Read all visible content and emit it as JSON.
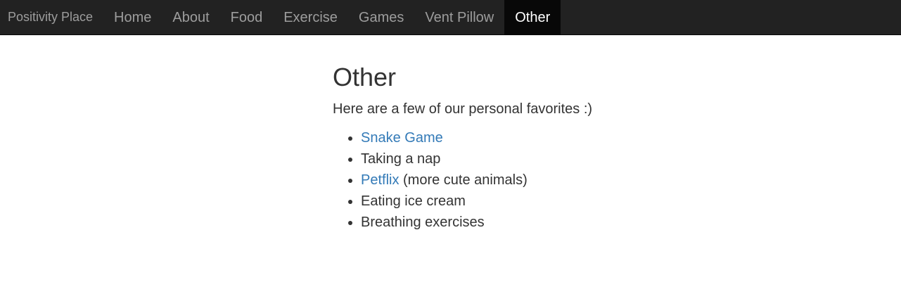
{
  "navbar": {
    "brand": "Positivity Place",
    "items": [
      {
        "label": "Home"
      },
      {
        "label": "About"
      },
      {
        "label": "Food"
      },
      {
        "label": "Exercise"
      },
      {
        "label": "Games"
      },
      {
        "label": "Vent Pillow"
      },
      {
        "label": "Other"
      }
    ],
    "active": "Other"
  },
  "main": {
    "title": "Other",
    "intro": "Here are a few of our personal favorites :)",
    "favorites": [
      {
        "link": "Snake Game",
        "text": ""
      },
      {
        "link": "",
        "text": "Taking a nap"
      },
      {
        "link": "Petflix",
        "text": " (more cute animals)"
      },
      {
        "link": "",
        "text": "Eating ice cream"
      },
      {
        "link": "",
        "text": "Breathing exercises"
      }
    ]
  },
  "colors": {
    "navbar_bg": "#222222",
    "active_bg": "#080808",
    "nav_text": "#9d9d9d",
    "link": "#337ab7",
    "body_text": "#333333"
  }
}
